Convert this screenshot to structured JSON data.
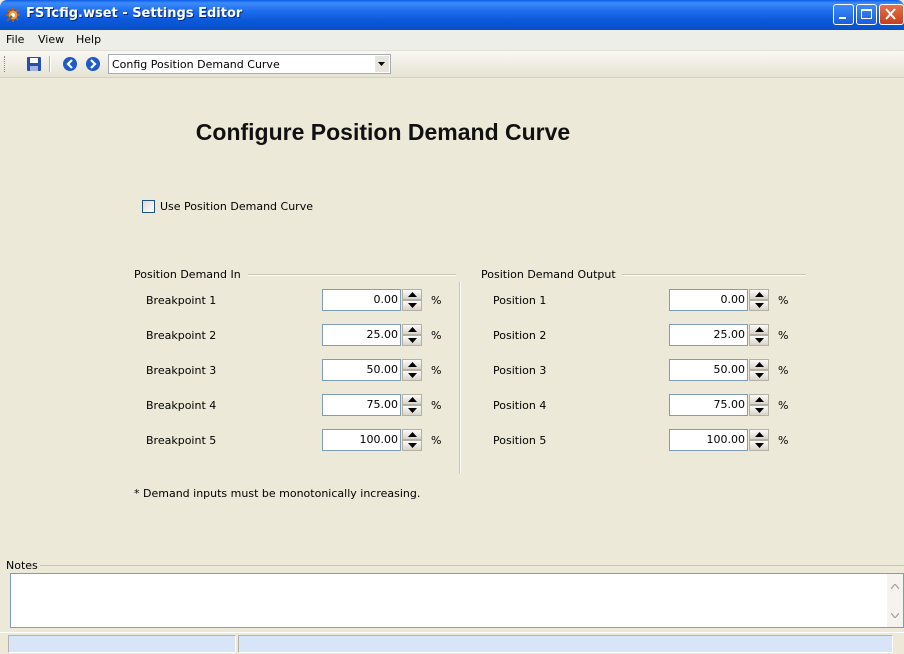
{
  "window": {
    "title": "FSTcfig.wset - Settings Editor",
    "app_icon": "settings-gear-icon",
    "accent_color": "#0A58D8"
  },
  "menu": {
    "file": "File",
    "view": "View",
    "help": "Help"
  },
  "toolbar": {
    "save_icon": "floppy-disk-icon",
    "back_icon": "arrow-left-circle-icon",
    "forward_icon": "arrow-right-circle-icon",
    "page_select": "Config Position Demand Curve"
  },
  "page": {
    "heading": "Configure Position Demand Curve",
    "use_curve_label": "Use Position Demand Curve",
    "use_curve_checked": false,
    "footnote": "* Demand inputs must be monotonically increasing."
  },
  "demand_in": {
    "title": "Position Demand In",
    "unit": "%",
    "rows": [
      {
        "label": "Breakpoint 1",
        "value": "0.00"
      },
      {
        "label": "Breakpoint 2",
        "value": "25.00"
      },
      {
        "label": "Breakpoint 3",
        "value": "50.00"
      },
      {
        "label": "Breakpoint 4",
        "value": "75.00"
      },
      {
        "label": "Breakpoint 5",
        "value": "100.00"
      }
    ]
  },
  "demand_out": {
    "title": "Position Demand Output",
    "unit": "%",
    "rows": [
      {
        "label": "Position 1",
        "value": "0.00"
      },
      {
        "label": "Position 2",
        "value": "25.00"
      },
      {
        "label": "Position 3",
        "value": "50.00"
      },
      {
        "label": "Position 4",
        "value": "75.00"
      },
      {
        "label": "Position 5",
        "value": "100.00"
      }
    ]
  },
  "notes": {
    "title": "Notes",
    "value": ""
  }
}
